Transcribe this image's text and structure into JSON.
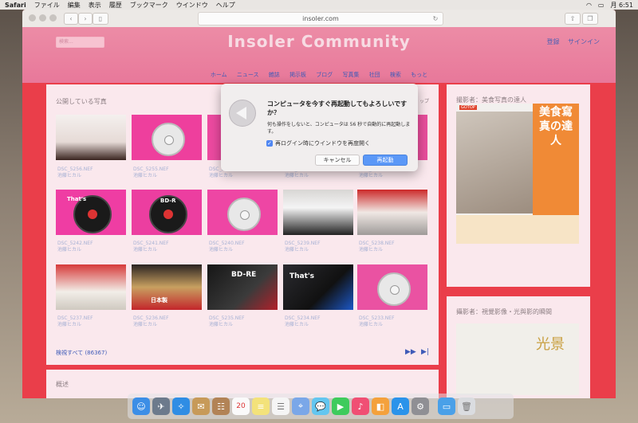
{
  "menubar": {
    "app": "Safari",
    "items": [
      "ファイル",
      "編集",
      "表示",
      "履歴",
      "ブックマーク",
      "ウインドウ",
      "ヘルプ"
    ],
    "clock": "月 6:51"
  },
  "browser": {
    "url": "insoler.com"
  },
  "site": {
    "title": "Insoler Community",
    "search_placeholder": "検索...",
    "register": "登録",
    "signin": "サインイン",
    "nav": [
      "ホーム",
      "ニュース",
      "雑誌",
      "掲示板",
      "ブログ",
      "写真集",
      "社団",
      "検索",
      "もっと"
    ]
  },
  "photos": {
    "title": "公開している写真",
    "tab_right": "ップ",
    "author": "池藤ヒカル",
    "items": [
      {
        "name": "DSC_5256.NEF"
      },
      {
        "name": "DSC_5255.NEF"
      },
      {
        "name": "DSC_5247.NEF"
      },
      {
        "name": "DSC_5244.NEF"
      },
      {
        "name": "DSC_5243.NEF"
      },
      {
        "name": "DSC_5242.NEF"
      },
      {
        "name": "DSC_5241.NEF"
      },
      {
        "name": "DSC_5240.NEF"
      },
      {
        "name": "DSC_5239.NEF"
      },
      {
        "name": "DSC_5238.NEF"
      },
      {
        "name": "DSC_5237.NEF"
      },
      {
        "name": "DSC_5236.NEF"
      },
      {
        "name": "DSC_5235.NEF"
      },
      {
        "name": "DSC_5234.NEF"
      },
      {
        "name": "DSC_5233.NEF"
      }
    ],
    "overlay_texts": [
      "That's",
      "BD-R",
      "BD-RE",
      "That's",
      "日本製"
    ],
    "view_all": "検視すべて (86367)"
  },
  "overview": {
    "title": "概述"
  },
  "sidebar": {
    "book1_title": "撮影者：美食写真の達人",
    "book1_cover": "美食寫真の達人",
    "book1_publisher": "GOTOP",
    "book2_title": "攝影者：視覺影像・光與影的瞬間",
    "book2_cover": "光景"
  },
  "dialog": {
    "title": "コンピュータを今すぐ再起動してもよろしいですか？",
    "message": "何も操作をしないと、コンピュータは 56 秒で自動的に再起動します。",
    "checkbox": "再ログイン時にウインドウを再度開く",
    "cancel": "キャンセル",
    "restart": "再起動"
  },
  "dock": {
    "calendar_day": "20"
  },
  "colors": {
    "page_bg": "#ea3e4a",
    "header_bg": "#ec8ca6",
    "link": "#3f5bb8",
    "primary_button": "#5b98f7"
  }
}
